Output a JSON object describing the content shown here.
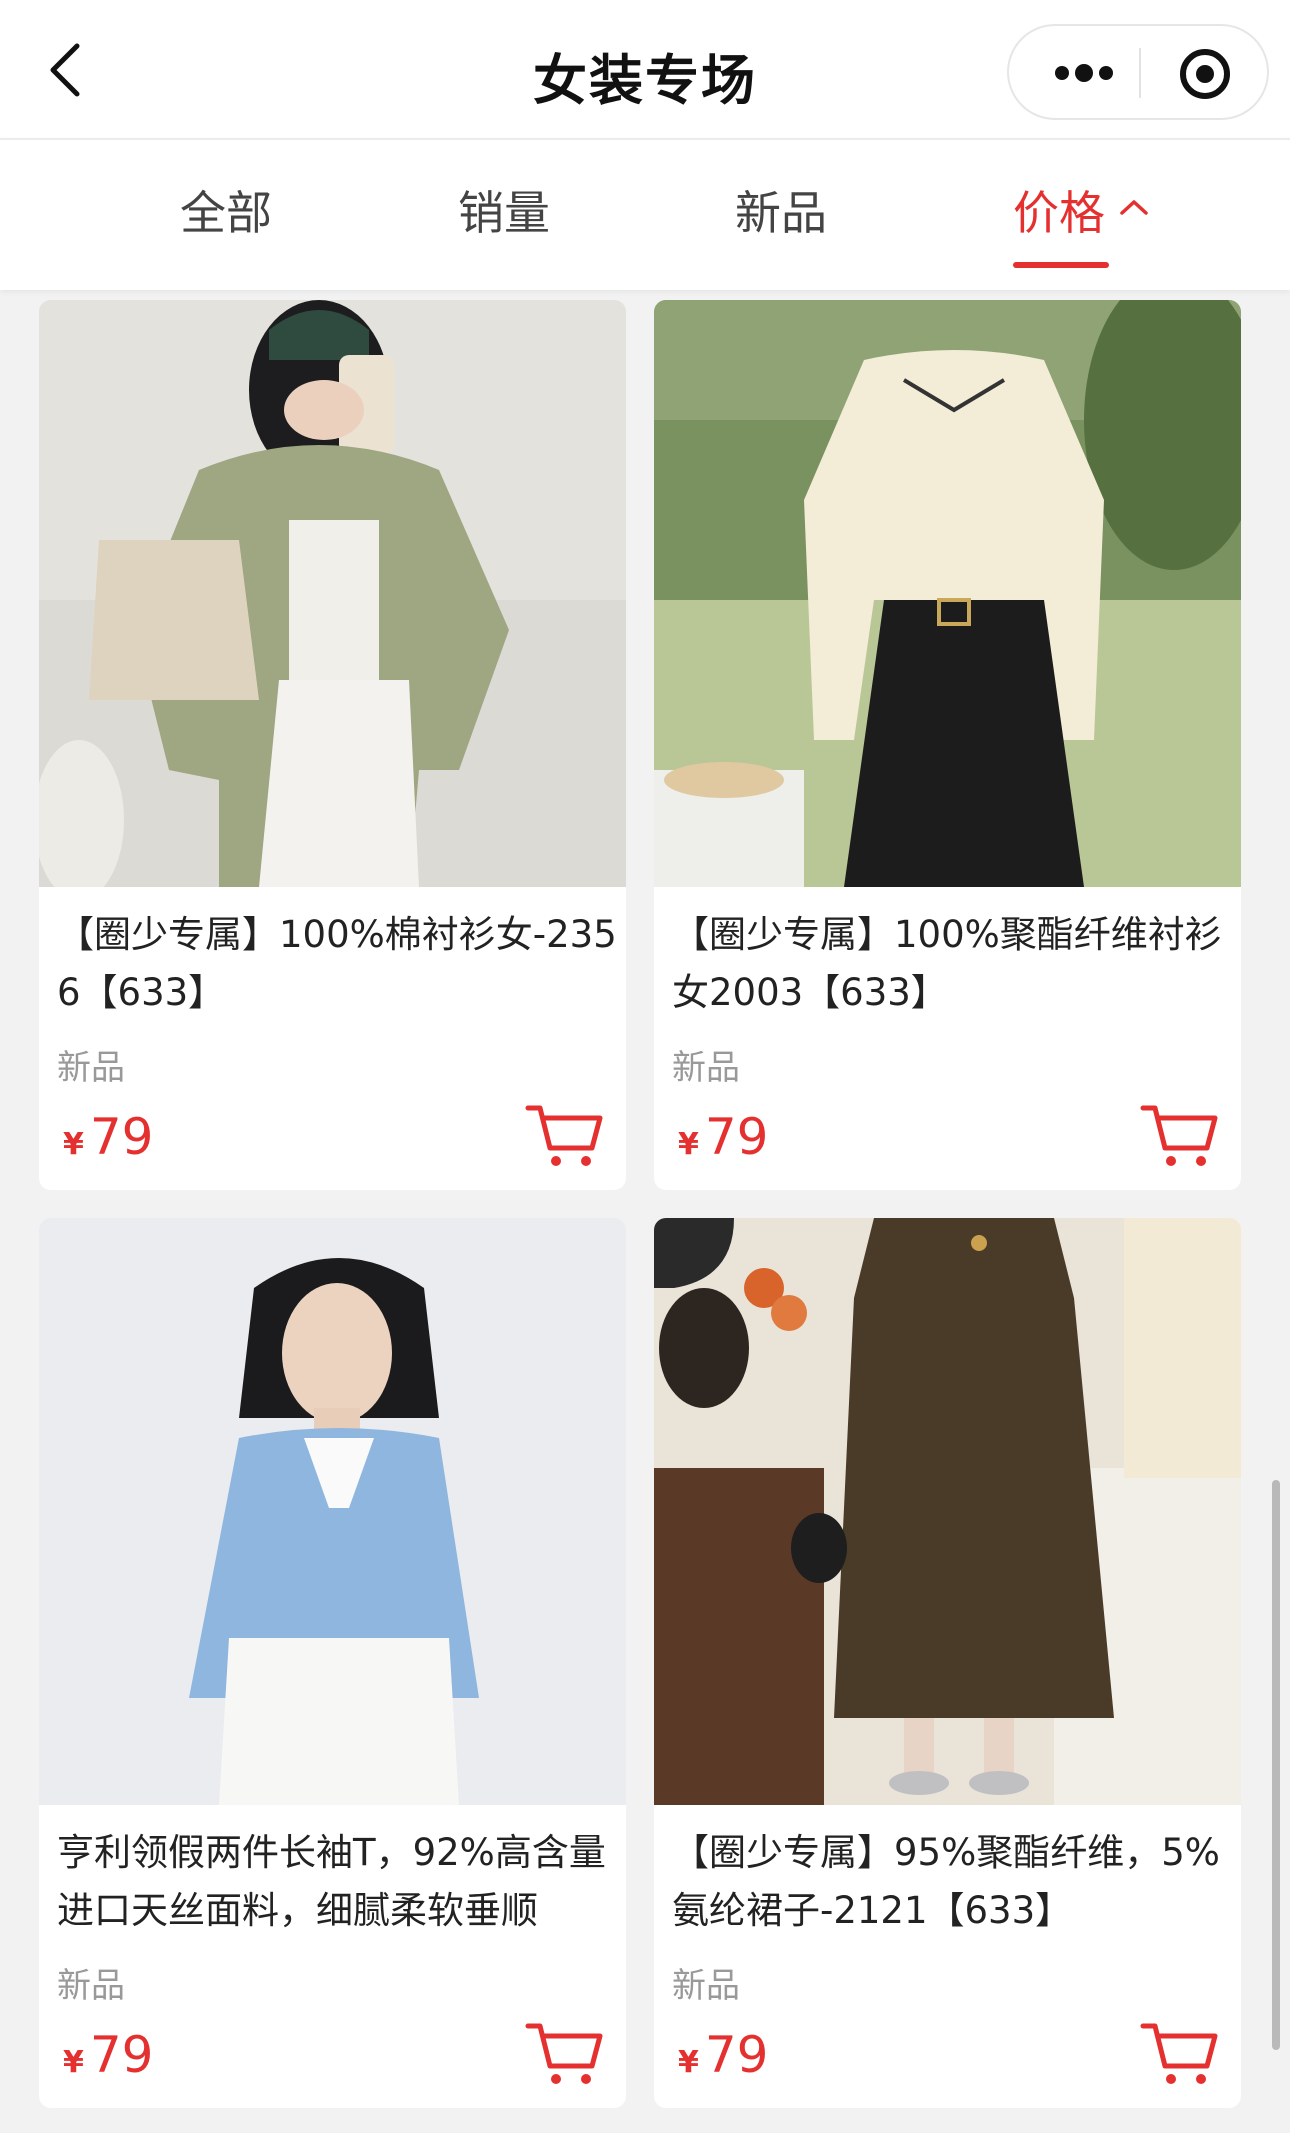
{
  "header": {
    "title": "女装专场"
  },
  "tabs": [
    {
      "label": "全部"
    },
    {
      "label": "销量"
    },
    {
      "label": "新品"
    },
    {
      "label": "价格"
    }
  ],
  "colors": {
    "accent": "#e53030",
    "background": "#f2f2f2"
  },
  "icons": {
    "back": "chevron-left-icon",
    "more": "more-dots-icon",
    "close": "close-target-icon",
    "sort": "caret-up-icon",
    "cart": "cart-icon"
  },
  "products": [
    {
      "name": "【圈少专属】100%棉衬衫女-2356【633】",
      "tag": "新品",
      "currency": "¥",
      "price": "79"
    },
    {
      "name": "【圈少专属】100%聚酯纤维衬衫女2003【633】",
      "tag": "新品",
      "currency": "¥",
      "price": "79"
    },
    {
      "name": "亨利领假两件长袖T，92%高含量进口天丝面料，细腻柔软垂顺",
      "tag": "新品",
      "currency": "¥",
      "price": "79"
    },
    {
      "name": "【圈少专属】95%聚酯纤维，5%氨纶裙子-2121【633】",
      "tag": "新品",
      "currency": "¥",
      "price": "79"
    }
  ]
}
